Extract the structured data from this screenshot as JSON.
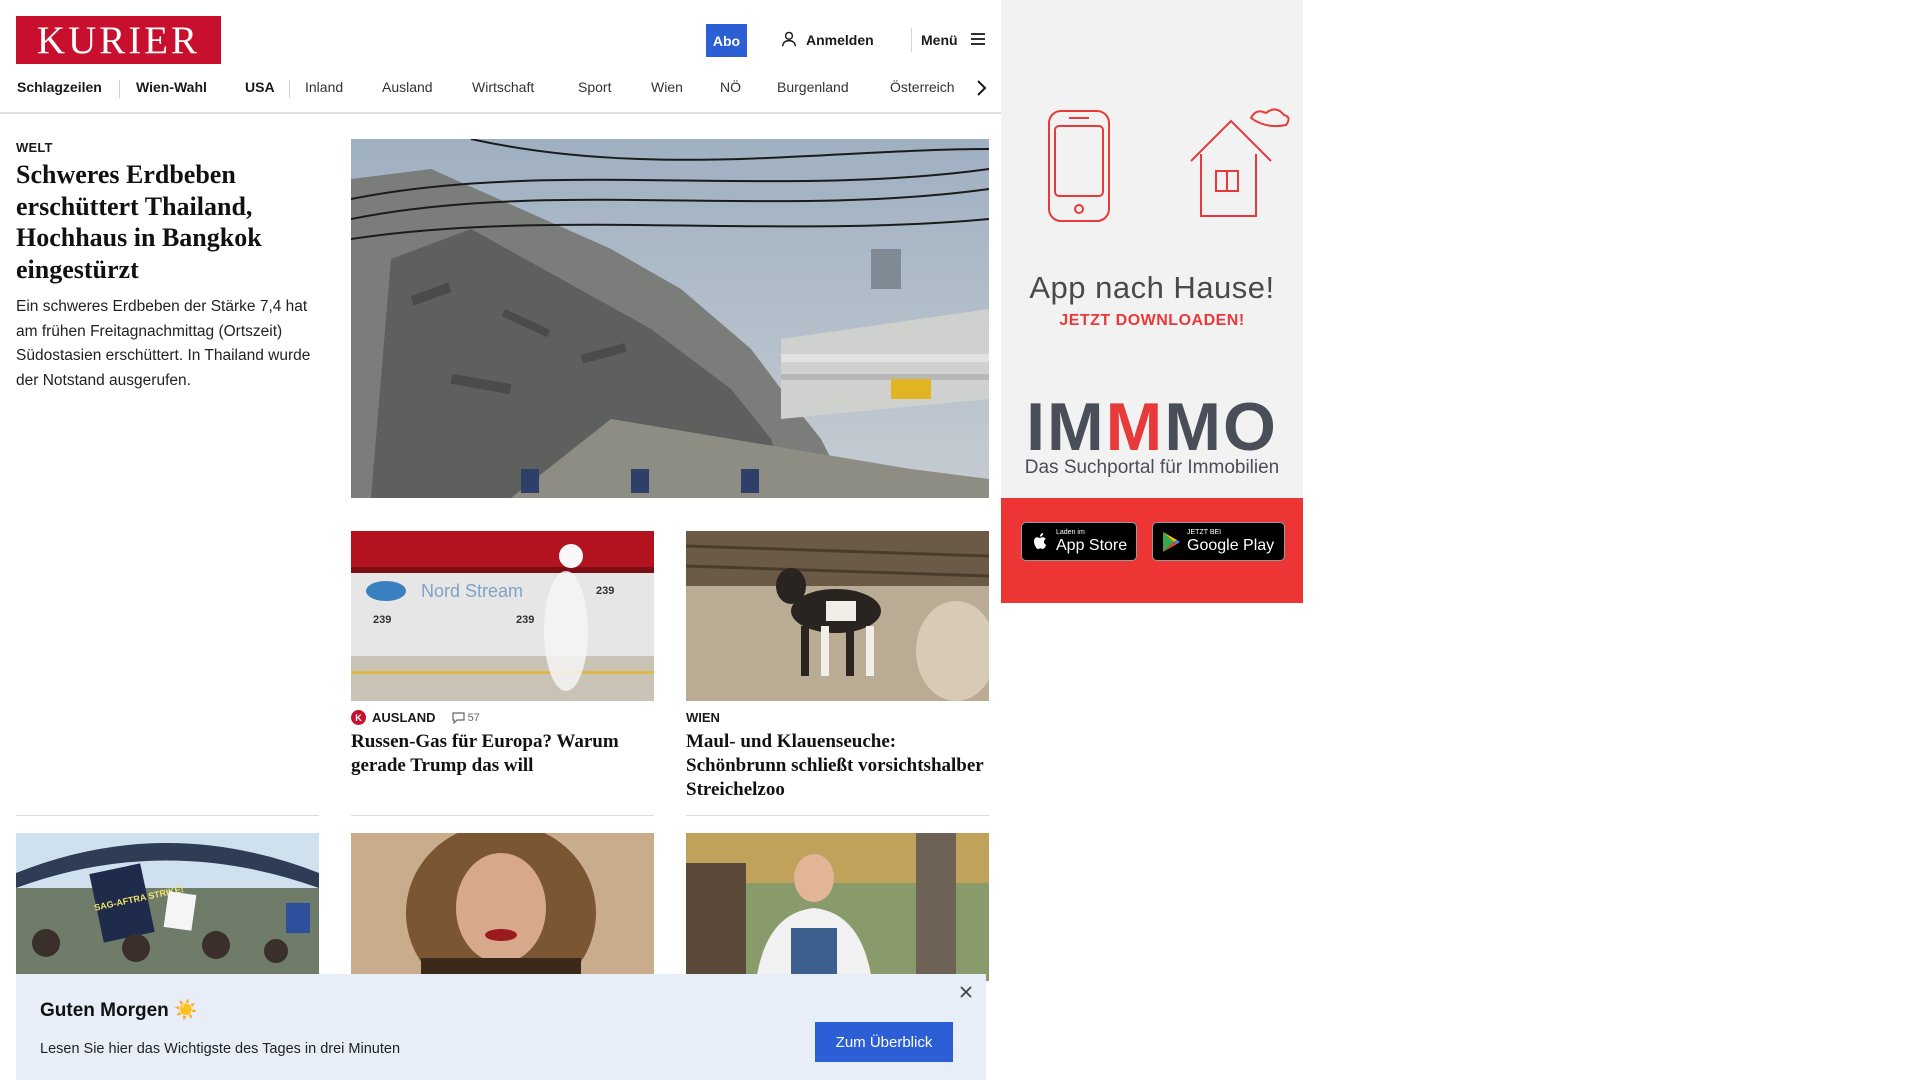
{
  "header": {
    "logo": "KURIER",
    "abo_label": "Abo",
    "login_label": "Anmelden",
    "menu_label": "Menü"
  },
  "nav": {
    "items": [
      "Schlagzeilen",
      "Wien-Wahl",
      "USA",
      "Inland",
      "Ausland",
      "Wirtschaft",
      "Sport",
      "Wien",
      "NÖ",
      "Burgenland",
      "Österreich"
    ]
  },
  "hero": {
    "kicker": "WELT",
    "title": "Schweres Erdbeben erschüttert Thailand, Hochhaus in Bangkok eingestürzt",
    "lead": "Ein schweres Erdbeben der Stärke 7,4 hat am frühen Freitagnachmittag (Ortszeit) Südostasien erschüttert. In Thailand wurde der Notstand ausgerufen."
  },
  "teasers": [
    {
      "kicker": "AUSLAND",
      "badge": "K",
      "comments": "57",
      "title": "Russen-Gas für Europa? Warum gerade Trump das will",
      "image_text": "Nord Stream",
      "image_numbers": [
        "239",
        "239",
        "239"
      ]
    },
    {
      "kicker": "WIEN",
      "title": "Maul- und Klauenseuche: Schönbrunn schließt vorsichtshalber Streichelzoo"
    }
  ],
  "bottom_images": {
    "strike_sign": "SAG-AFTRA STRIKE!"
  },
  "ad": {
    "title": "App nach Hause!",
    "subtitle": "JETZT DOWNLOADEN!",
    "brand_start": "IM",
    "brand_mid": "M",
    "brand_end": "MO",
    "tagline": "Das Suchportal für Immobilien",
    "appstore_small": "Laden im",
    "appstore_big": "App Store",
    "googleplay_small": "JETZT BEI",
    "googleplay_big": "Google Play"
  },
  "banner": {
    "title": "Guten Morgen ☀️",
    "text": "Lesen Sie hier das Wichtigste des Tages in drei Minuten",
    "button": "Zum Überblick"
  },
  "colors": {
    "brand_red": "#c8102e",
    "accent_blue": "#2c5fd6",
    "ad_red": "#ee3535",
    "banner_bg": "#e8eef8"
  }
}
